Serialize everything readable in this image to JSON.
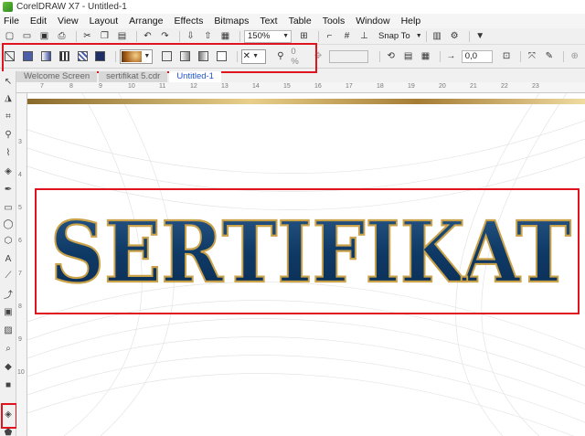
{
  "window": {
    "title": "CorelDRAW X7 - Untitled-1"
  },
  "menu": {
    "items": [
      "File",
      "Edit",
      "View",
      "Layout",
      "Arrange",
      "Effects",
      "Bitmaps",
      "Text",
      "Table",
      "Tools",
      "Window",
      "Help"
    ]
  },
  "toolbar": {
    "zoom": "150%",
    "snap_to": "Snap To"
  },
  "property_bar": {
    "transparency": "0 %",
    "nudge": "0,0"
  },
  "doc_tabs": [
    "Welcome Screen",
    "sertifikat 5.cdr",
    "Untitled-1"
  ],
  "ruler": {
    "h_labels": [
      "7",
      "8",
      "9",
      "10",
      "11",
      "12",
      "13",
      "14",
      "15",
      "16",
      "17",
      "18",
      "19",
      "20",
      "21",
      "22",
      "23"
    ],
    "v_labels": [
      "3",
      "4",
      "5",
      "6",
      "7",
      "8",
      "9",
      "10"
    ]
  },
  "canvas": {
    "heading": "SERTIFIKAT"
  },
  "colors": {
    "title_fill": "#0f3a66",
    "outline_gold": "#c9a24a",
    "highlight": "#e0141e"
  }
}
